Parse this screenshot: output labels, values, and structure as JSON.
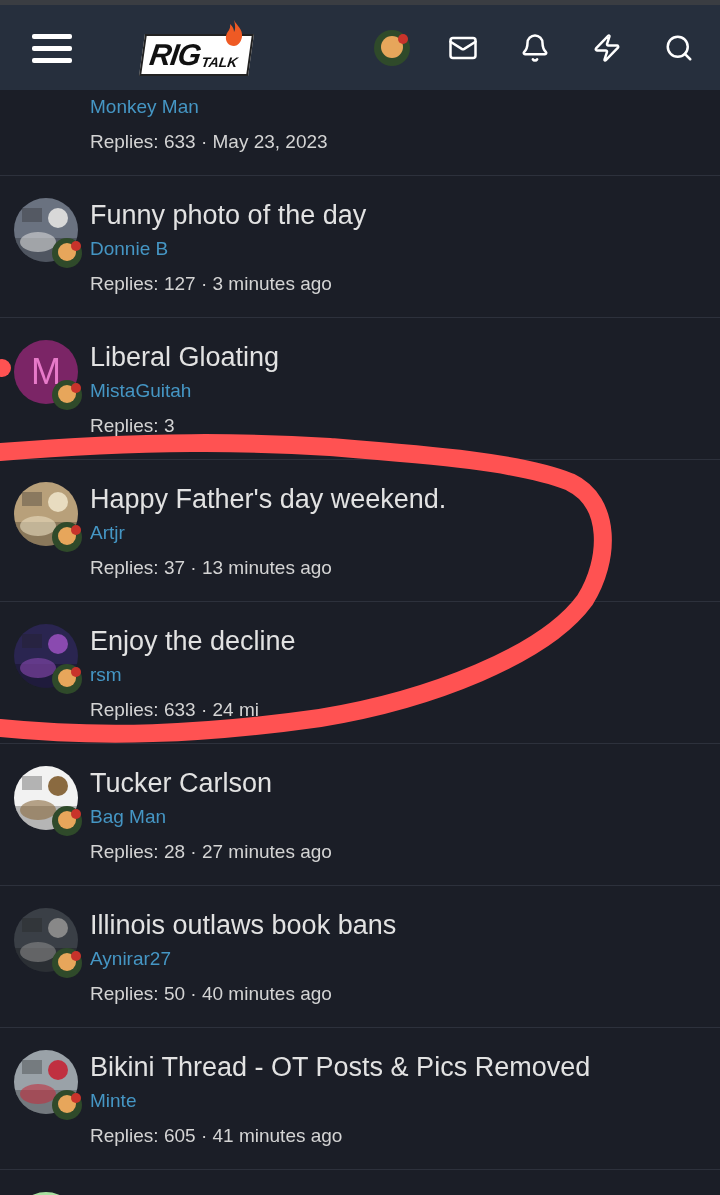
{
  "header": {
    "logo": {
      "main": "RIG",
      "sub": "TALK"
    }
  },
  "threads": [
    {
      "author": "Monkey Man",
      "meta": "Replies: 633 · May 23, 2023",
      "avatar": {
        "kind": "none"
      }
    },
    {
      "title": "Funny photo of the day",
      "author": "Donnie B",
      "meta": "Replies: 127 · 3 minutes ago"
    },
    {
      "title": "Liberal Gloating",
      "author": "MistaGuitah",
      "meta": "Replies: 3",
      "avatar": {
        "kind": "letter",
        "letter": "M",
        "color": "#7b2566"
      }
    },
    {
      "title": "Happy Father's day weekend.",
      "author": "Artjr",
      "meta": "Replies: 37 · 13 minutes ago"
    },
    {
      "title": "Enjoy the decline",
      "author": "rsm",
      "meta": "Replies: 633 · 24 mi"
    },
    {
      "title": "Tucker Carlson",
      "author": "Bag Man",
      "meta": "Replies: 28 · 27 minutes ago"
    },
    {
      "title": "Illinois outlaws book bans",
      "author": "Aynirar27",
      "meta": "Replies: 50 · 40 minutes ago"
    },
    {
      "title": "Bikini Thread - OT Posts & Pics Removed",
      "author": "Minte",
      "meta": "Replies: 605 · 41 minutes ago"
    },
    {
      "avatar": {
        "kind": "letter",
        "color": "#a8e0a0"
      }
    }
  ]
}
